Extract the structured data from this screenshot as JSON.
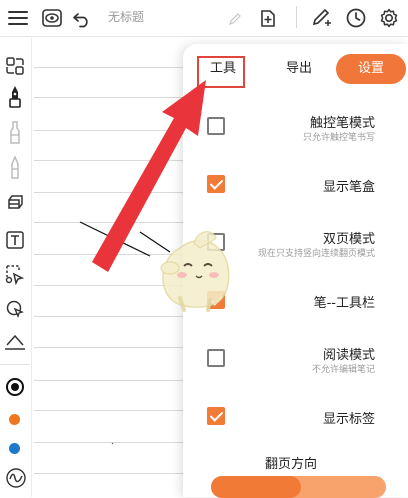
{
  "toolbar": {
    "title_placeholder": "无标题",
    "icons": [
      "menu-icon",
      "view-icon",
      "undo-icon",
      "pencil-icon",
      "add-page-icon",
      "pen-settings-icon",
      "clock-icon",
      "gear-icon"
    ]
  },
  "left_tools": [
    "select-icon",
    "fountain-pen-icon",
    "highlighter-icon",
    "marker-icon",
    "eraser-icon",
    "text-icon",
    "lasso-icon",
    "shape-icon",
    "ruler-icon"
  ],
  "colors": {
    "pen_black": "#111111",
    "pen_orange": "#f0771f",
    "pen_blue": "#1f78c8",
    "accent": "#f0763a",
    "arrow": "#e8343a"
  },
  "panel": {
    "tabs": {
      "tools": "工具",
      "export": "导出",
      "settings": "设置"
    },
    "options": [
      {
        "label": "触控笔模式",
        "sub": "只允许触控笔书写",
        "checked": false
      },
      {
        "label": "显示笔盒",
        "sub": "",
        "checked": true
      },
      {
        "label": "双页模式",
        "sub": "现在只支持竖向连续翻页模式",
        "checked": false
      },
      {
        "label": "笔--工具栏",
        "sub": "",
        "checked": true
      },
      {
        "label": "阅读模式",
        "sub": "不允许编辑笔记",
        "checked": false
      },
      {
        "label": "显示标签",
        "sub": "",
        "checked": true
      }
    ],
    "page_direction_label": "翻页方向"
  }
}
